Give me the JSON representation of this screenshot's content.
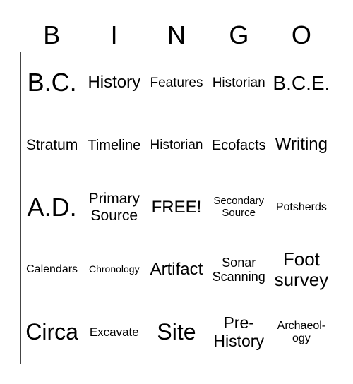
{
  "header": [
    "B",
    "I",
    "N",
    "G",
    "O"
  ],
  "cells": [
    {
      "text": "B.C.",
      "size": 36
    },
    {
      "text": "History",
      "size": 24
    },
    {
      "text": "Features",
      "size": 19
    },
    {
      "text": "Historian",
      "size": 19
    },
    {
      "text": "B.C.E.",
      "size": 28
    },
    {
      "text": "Stratum",
      "size": 21
    },
    {
      "text": "Timeline",
      "size": 20
    },
    {
      "text": "Historian",
      "size": 19
    },
    {
      "text": "Ecofacts",
      "size": 20
    },
    {
      "text": "Writing",
      "size": 24
    },
    {
      "text": "A.D.",
      "size": 36
    },
    {
      "text": "Primary Source",
      "size": 21
    },
    {
      "text": "FREE!",
      "size": 24
    },
    {
      "text": "Secondary Source",
      "size": 15
    },
    {
      "text": "Potsherds",
      "size": 16
    },
    {
      "text": "Calendars",
      "size": 16
    },
    {
      "text": "Chronology",
      "size": 14
    },
    {
      "text": "Artifact",
      "size": 24
    },
    {
      "text": "Sonar Scanning",
      "size": 18
    },
    {
      "text": "Foot survey",
      "size": 26
    },
    {
      "text": "Circa",
      "size": 32
    },
    {
      "text": "Excavate",
      "size": 17
    },
    {
      "text": "Site",
      "size": 32
    },
    {
      "text": "Pre-History",
      "size": 23
    },
    {
      "text": "Archaeol-ogy",
      "size": 16
    }
  ]
}
